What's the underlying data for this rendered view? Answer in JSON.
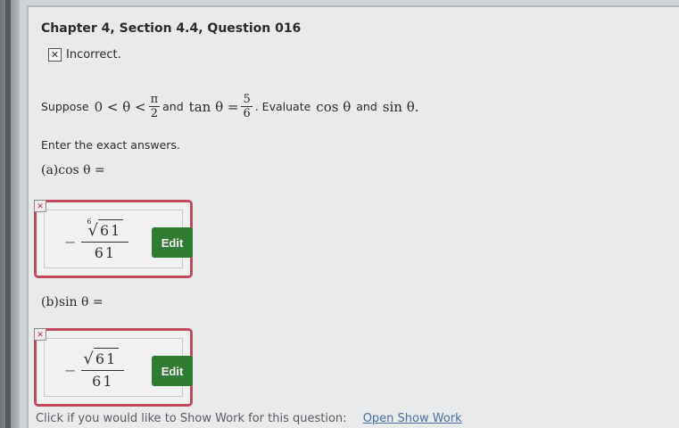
{
  "header": {
    "title": "Chapter 4, Section 4.4, Question 016"
  },
  "status": {
    "icon": "x-box-icon",
    "text": "Incorrect."
  },
  "question": {
    "prefix": "Suppose",
    "ineq_left": "0 < θ <",
    "pi_num": "π",
    "pi_den": "2",
    "and_text": "and",
    "tan_left": "tan θ =",
    "tan_num": "5",
    "tan_den": "6",
    "evaluate_text": ". Evaluate",
    "cos_text": "cos  θ",
    "and_text2": "and",
    "sin_text": "sin  θ."
  },
  "instruction": "Enter the exact answers.",
  "parts": [
    {
      "label": "(a)cos  θ =",
      "answer": {
        "sign": "−",
        "root_index": "6",
        "radicand": "61",
        "denominator": "61"
      },
      "edit_label": "Edit"
    },
    {
      "label": "(b)sin  θ =",
      "answer": {
        "sign": "−",
        "root_index": "",
        "radicand": "61",
        "denominator": "61"
      },
      "edit_label": "Edit"
    }
  ],
  "footer": {
    "text": "Click if you would like to Show Work for this question:",
    "link": "Open Show Work"
  },
  "colors": {
    "edit_button": "#2f7d32",
    "incorrect_border": "#c04a5e",
    "link": "#4a6fa5"
  }
}
